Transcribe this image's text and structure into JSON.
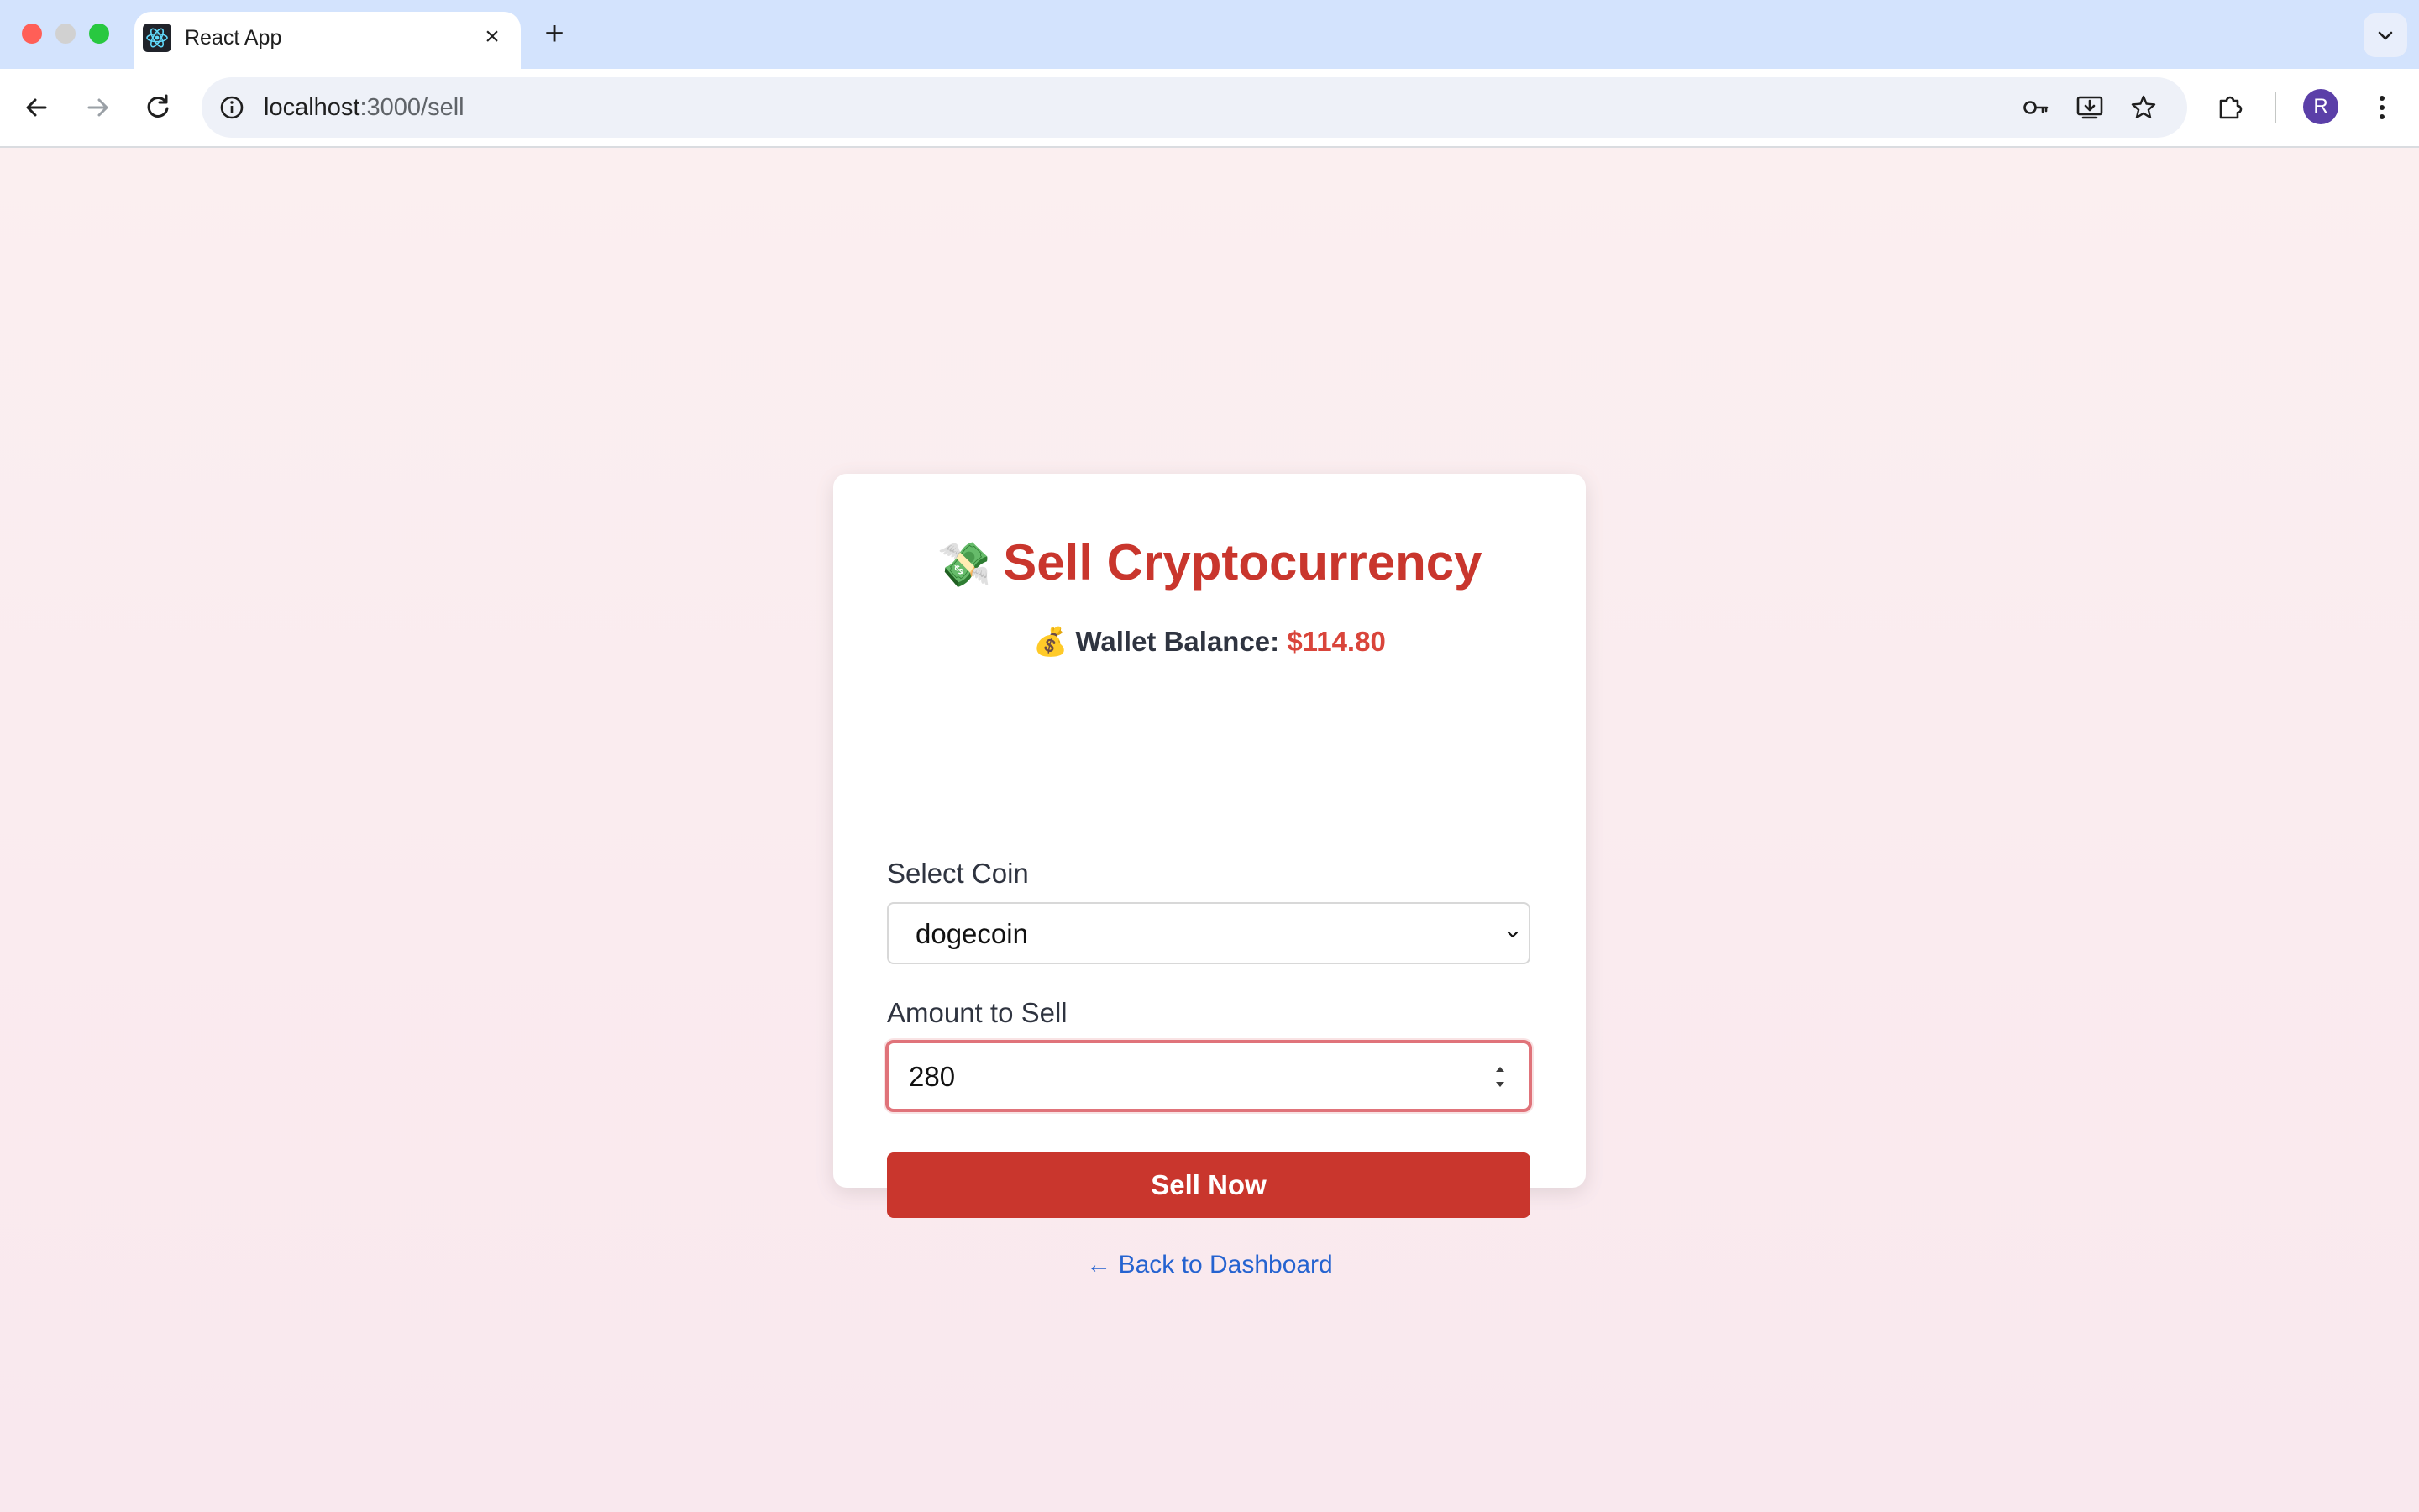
{
  "browser": {
    "tab_title": "React App",
    "tab_close": "×",
    "new_tab": "+",
    "url_host": "localhost",
    "url_path": ":3000/sell",
    "avatar_initial": "R"
  },
  "page": {
    "title_emoji": "💸",
    "title": "Sell Cryptocurrency",
    "balance_emoji": "💰",
    "balance_label": "Wallet Balance:",
    "balance_amount": "$114.80",
    "coin_label": "Select Coin",
    "coin_value": "dogecoin",
    "amount_label": "Amount to Sell",
    "amount_value": "280",
    "sell_button": "Sell Now",
    "back_link": "← Back to Dashboard"
  },
  "colors": {
    "accent": "#c9362d",
    "balance_amount": "#d9453b",
    "link": "#2563d0",
    "input_focus_border": "#e0737a"
  }
}
